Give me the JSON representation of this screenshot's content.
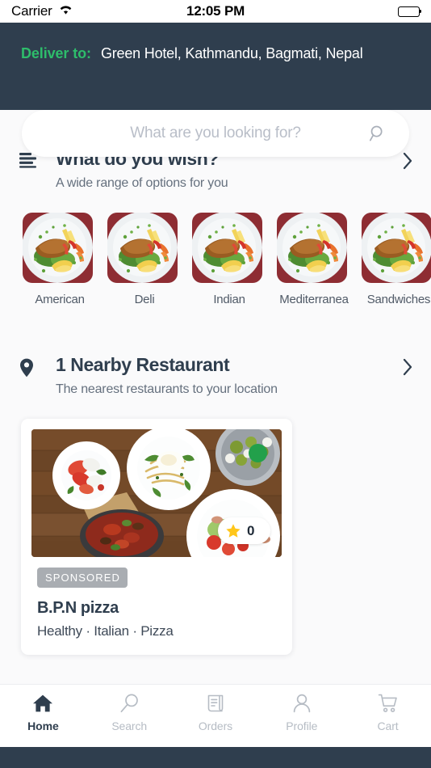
{
  "status_bar": {
    "carrier": "Carrier",
    "wifi_icon": "wifi-icon",
    "time": "12:05 PM",
    "battery_icon": "battery-full-icon"
  },
  "header": {
    "background_color": "#2f3e4e",
    "deliver_label": "Deliver to:",
    "deliver_label_color": "#2ebd6b",
    "address": "Green Hotel, Kathmandu, Bagmati, Nepal"
  },
  "search": {
    "placeholder": "What are you looking for?",
    "value": "",
    "icon": "search-icon"
  },
  "wish_section": {
    "icon": "list-lines-icon",
    "title": "What do you wish?",
    "subtitle": "A wide range of options for you",
    "chevron": "chevron-right-icon",
    "categories": [
      {
        "label": "American",
        "image": "plated-dish-photo"
      },
      {
        "label": "Deli",
        "image": "plated-dish-photo"
      },
      {
        "label": "Indian",
        "image": "plated-dish-photo"
      },
      {
        "label": "Mediterranea",
        "image": "plated-dish-photo"
      },
      {
        "label": "Sandwiches",
        "image": "plated-dish-photo"
      }
    ]
  },
  "nearby_section": {
    "icon": "location-pin-icon",
    "title": "1 Nearby Restaurant",
    "subtitle": "The nearest restaurants to your location",
    "chevron": "chevron-right-icon",
    "restaurants": [
      {
        "image": "food-spread-table-photo",
        "open_status_color": "#22a04b",
        "rating_icon": "star-icon",
        "rating": "0",
        "badge": "SPONSORED",
        "name": "B.P.N pizza",
        "tags": "Healthy · Italian · Pizza"
      }
    ]
  },
  "tabbar": {
    "active_color": "#2f3e4e",
    "inactive_color": "#b6bcc4",
    "items": [
      {
        "label": "Home",
        "icon": "home-icon",
        "active": true
      },
      {
        "label": "Search",
        "icon": "search-icon",
        "active": false
      },
      {
        "label": "Orders",
        "icon": "receipt-icon",
        "active": false
      },
      {
        "label": "Profile",
        "icon": "person-icon",
        "active": false
      },
      {
        "label": "Cart",
        "icon": "cart-icon",
        "active": false
      }
    ]
  }
}
